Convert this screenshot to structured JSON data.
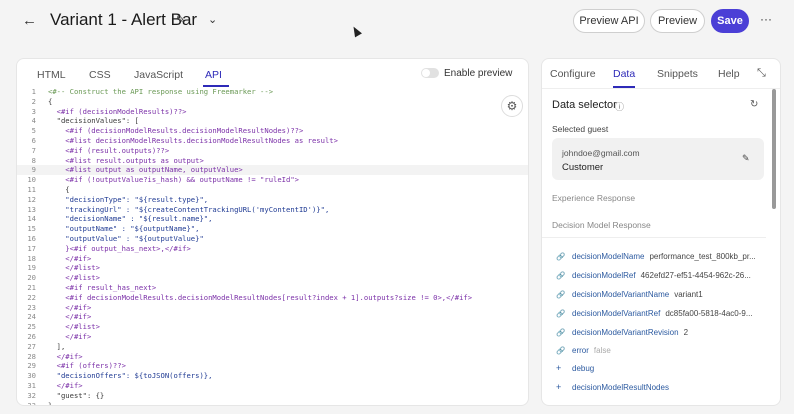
{
  "header": {
    "title": "Variant 1 - Alert Bar",
    "back_glyph": "←",
    "edit_glyph": "✎",
    "dropdown_glyph": "⌄",
    "preview_api_label": "Preview API",
    "preview_label": "Preview",
    "save_label": "Save",
    "more_glyph": "···"
  },
  "editor": {
    "tabs": [
      "HTML",
      "CSS",
      "JavaScript",
      "API"
    ],
    "active_tab": "API",
    "enable_preview_label": "Enable preview",
    "settings_glyph": "⚙",
    "highlighted_line": 9,
    "code_lines": [
      {
        "n": "1",
        "t": "<#-- Construct the API response using Freemarker -->",
        "c": "cmt"
      },
      {
        "n": "2",
        "t": "{",
        "c": ""
      },
      {
        "n": "3",
        "t": "  <#if (decisionModelResults)??>",
        "c": "tag"
      },
      {
        "n": "4",
        "t": "  \"decisionValues\": [",
        "c": ""
      },
      {
        "n": "5",
        "t": "    <#if (decisionModelResults.decisionModelResultNodes)??>",
        "c": "tag"
      },
      {
        "n": "6",
        "t": "    <#list decisionModelResults.decisionModelResultNodes as result>",
        "c": "tag"
      },
      {
        "n": "7",
        "t": "    <#if (result.outputs)??>",
        "c": "tag"
      },
      {
        "n": "8",
        "t": "    <#list result.outputs as output>",
        "c": "tag"
      },
      {
        "n": "9",
        "t": "    <#list output as outputName, outputValue>",
        "c": "tag"
      },
      {
        "n": "10",
        "t": "    <#if (!outputValue?is_hash) && outputName != \"ruleId\">",
        "c": "tag"
      },
      {
        "n": "11",
        "t": "    {",
        "c": ""
      },
      {
        "n": "12",
        "t": "    \"decisionType\": \"${result.type}\",",
        "c": "str"
      },
      {
        "n": "13",
        "t": "    \"trackingUrl\" : \"${createContentTrackingURL('myContentID')}\",",
        "c": "str"
      },
      {
        "n": "14",
        "t": "    \"decisionName\" : \"${result.name}\",",
        "c": "str"
      },
      {
        "n": "15",
        "t": "    \"outputName\" : \"${outputName}\",",
        "c": "str"
      },
      {
        "n": "16",
        "t": "    \"outputValue\" : \"${outputValue}\"",
        "c": "str"
      },
      {
        "n": "17",
        "t": "    }<#if output_has_next>,</#if>",
        "c": "tag"
      },
      {
        "n": "18",
        "t": "    </#if>",
        "c": "tag"
      },
      {
        "n": "19",
        "t": "    </#list>",
        "c": "tag"
      },
      {
        "n": "20",
        "t": "    </#list>",
        "c": "tag"
      },
      {
        "n": "21",
        "t": "    <#if result_has_next>",
        "c": "tag"
      },
      {
        "n": "22",
        "t": "    <#if decisionModelResults.decisionModelResultNodes[result?index + 1].outputs?size != 0>,</#if>",
        "c": "tag"
      },
      {
        "n": "23",
        "t": "    </#if>",
        "c": "tag"
      },
      {
        "n": "24",
        "t": "    </#if>",
        "c": "tag"
      },
      {
        "n": "25",
        "t": "    </#list>",
        "c": "tag"
      },
      {
        "n": "26",
        "t": "    </#if>",
        "c": "tag"
      },
      {
        "n": "27",
        "t": "  ],",
        "c": ""
      },
      {
        "n": "28",
        "t": "  </#if>",
        "c": "tag"
      },
      {
        "n": "29",
        "t": "  <#if (offers)??>",
        "c": "tag"
      },
      {
        "n": "30",
        "t": "  \"decisionOffers\": ${toJSON(offers)},",
        "c": "str"
      },
      {
        "n": "31",
        "t": "  </#if>",
        "c": "tag"
      },
      {
        "n": "32",
        "t": "  \"guest\": {}",
        "c": ""
      },
      {
        "n": "33",
        "t": "}",
        "c": ""
      }
    ]
  },
  "side": {
    "tabs": [
      "Configure",
      "Data",
      "Snippets",
      "Help"
    ],
    "active_tab": "Data",
    "collapse_glyph": "⤡",
    "data_selector_title": "Data selector",
    "info_glyph": "ⓘ",
    "refresh_glyph": "↻",
    "selected_guest_label": "Selected guest",
    "guest_email": "johndoe@gmail.com",
    "guest_name": "Customer",
    "guest_edit_glyph": "✎",
    "experience_response_label": "Experience Response",
    "decision_model_response_label": "Decision Model Response",
    "props": [
      {
        "key": "decisionModelName",
        "value": "performance_test_800kb_pr...",
        "icon": "🔗",
        "muted": false
      },
      {
        "key": "decisionModelRef",
        "value": "462efd27-ef51-4454-962c-26...",
        "icon": "🔗",
        "muted": false
      },
      {
        "key": "decisionModelVariantName",
        "value": "variant1",
        "icon": "🔗",
        "muted": false
      },
      {
        "key": "decisionModelVariantRef",
        "value": "dc85fa00-5818-4ac0-9...",
        "icon": "🔗",
        "muted": false
      },
      {
        "key": "decisionModelVariantRevision",
        "value": "2",
        "icon": "🔗",
        "muted": false
      },
      {
        "key": "error",
        "value": "false",
        "icon": "🔗",
        "muted": true
      },
      {
        "key": "debug",
        "value": "",
        "icon": "+",
        "muted": false
      },
      {
        "key": "decisionModelResultNodes",
        "value": "",
        "icon": "+",
        "muted": false
      }
    ]
  }
}
